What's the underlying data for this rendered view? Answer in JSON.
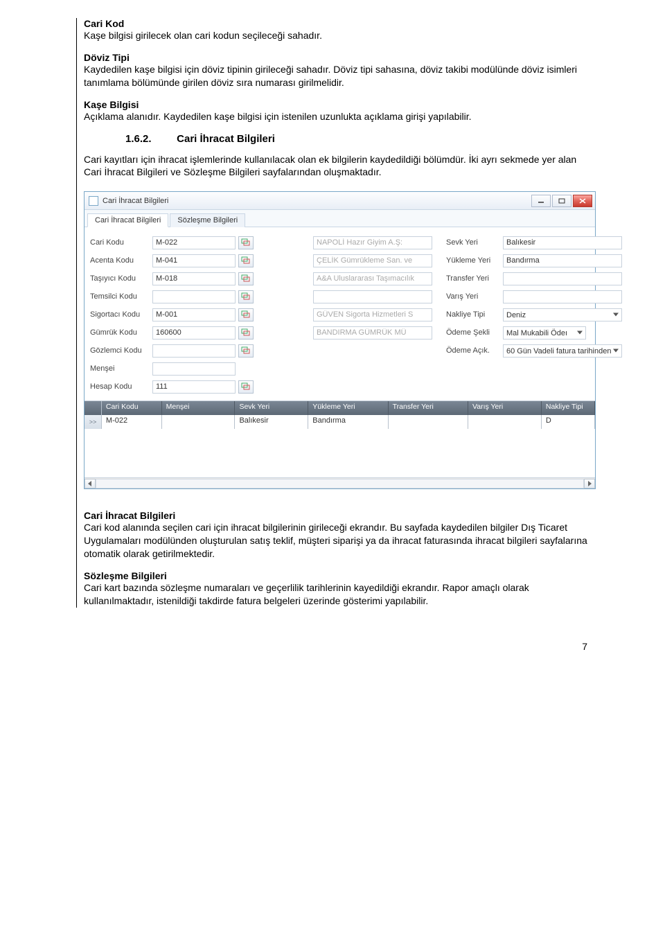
{
  "sections": {
    "s1": {
      "title": "Cari Kod",
      "body": "Kaşe bilgisi girilecek olan cari kodun seçileceği sahadır."
    },
    "s2": {
      "title": "Döviz Tipi",
      "body": "Kaydedilen kaşe bilgisi için döviz tipinin girileceği sahadır. Döviz tipi sahasına, döviz takibi modülünde döviz isimleri tanımlama bölümünde girilen döviz sıra numarası girilmelidir."
    },
    "s3": {
      "title": "Kaşe Bilgisi",
      "body": "Açıklama alanıdır. Kaydedilen kaşe bilgisi için istenilen uzunlukta açıklama girişi yapılabilir."
    },
    "h1": {
      "num": "1.6.2.",
      "title": "Cari İhracat Bilgileri"
    },
    "p1": "Cari kayıtları için ihracat işlemlerinde kullanılacak olan ek bilgilerin kaydedildiği bölümdür. İki ayrı sekmede yer alan Cari İhracat Bilgileri ve Sözleşme Bilgileri sayfalarından oluşmaktadır.",
    "s4": {
      "title": "Cari İhracat Bilgileri",
      "body": "Cari kod alanında seçilen cari için ihracat bilgilerinin girileceği ekrandır. Bu sayfada kaydedilen bilgiler Dış Ticaret Uygulamaları modülünden oluşturulan satış teklif, müşteri siparişi ya da ihracat faturasında ihracat bilgileri sayfalarına otomatik olarak getirilmektedir."
    },
    "s5": {
      "title": "Sözleşme Bilgileri",
      "body": "Cari kart bazında sözleşme numaraları ve geçerlilik tarihlerinin kayedildiği ekrandır. Rapor amaçlı olarak kullanılmaktadır, istenildiği takdirde fatura belgeleri üzerinde gösterimi yapılabilir."
    }
  },
  "window": {
    "title": "Cari İhracat Bilgileri",
    "tabs": {
      "t1": "Cari İhracat Bilgileri",
      "t2": "Sözleşme Bilgileri"
    },
    "labels": {
      "cariKodu": "Cari Kodu",
      "acentaKodu": "Acenta Kodu",
      "tasiyiciKodu": "Taşıyıcı Kodu",
      "temsilciKodu": "Temsilci Kodu",
      "sigortaciKodu": "Sigortacı Kodu",
      "gumrukKodu": "Gümrük Kodu",
      "gozlemciKodu": "Gözlemci Kodu",
      "mensei": "Menşei",
      "hesapKodu": "Hesap Kodu",
      "sevkYeri": "Sevk Yeri",
      "yuklemeYeri": "Yükleme Yeri",
      "transferYeri": "Transfer Yeri",
      "varisYeri": "Varış Yeri",
      "nakliyeTipi": "Nakliye Tipi",
      "odemeSekli": "Ödeme Şekli",
      "odemeAcik": "Ödeme Açık."
    },
    "values": {
      "cariKodu": "M-022",
      "cariDesc": "NAPOLİ Hazır Giyim A.Ş:",
      "acentaKodu": "M-041",
      "acentaDesc": "ÇELİK Gümrükleme San. ve",
      "tasiyiciKodu": "M-018",
      "tasiyiciDesc": "A&A Uluslararası Taşımacılık",
      "temsilciKodu": "",
      "temsilciDesc": "",
      "sigortaciKodu": "M-001",
      "sigortaciDesc": "GÜVEN Sigorta Hizmetleri S",
      "gumrukKodu": "160600",
      "gumrukDesc": "BANDIRMA GÜMRÜK MÜ",
      "gozlemciKodu": "",
      "mensei": "",
      "hesapKodu": "111",
      "sevkYeri": "Balıkesir",
      "yuklemeYeri": "Bandırma",
      "transferYeri": "",
      "varisYeri": "",
      "nakliyeTipi": "Deniz",
      "odemeSekli": "Mal Mukabili Ödeı",
      "odemeAcik": "60 Gün  Vadeli fatura tarihinden"
    },
    "grid": {
      "headers": {
        "c1": "Cari Kodu",
        "c2": "Menşei",
        "c3": "Sevk Yeri",
        "c4": "Yükleme Yeri",
        "c5": "Transfer Yeri",
        "c6": "Varış Yeri",
        "c7": "Nakliye Tipi"
      },
      "row1": {
        "c1": "M-022",
        "c2": "",
        "c3": "Balıkesir",
        "c4": "Bandırma",
        "c5": "",
        "c6": "",
        "c7": "D"
      },
      "marker": ">>"
    }
  },
  "pageNumber": "7"
}
